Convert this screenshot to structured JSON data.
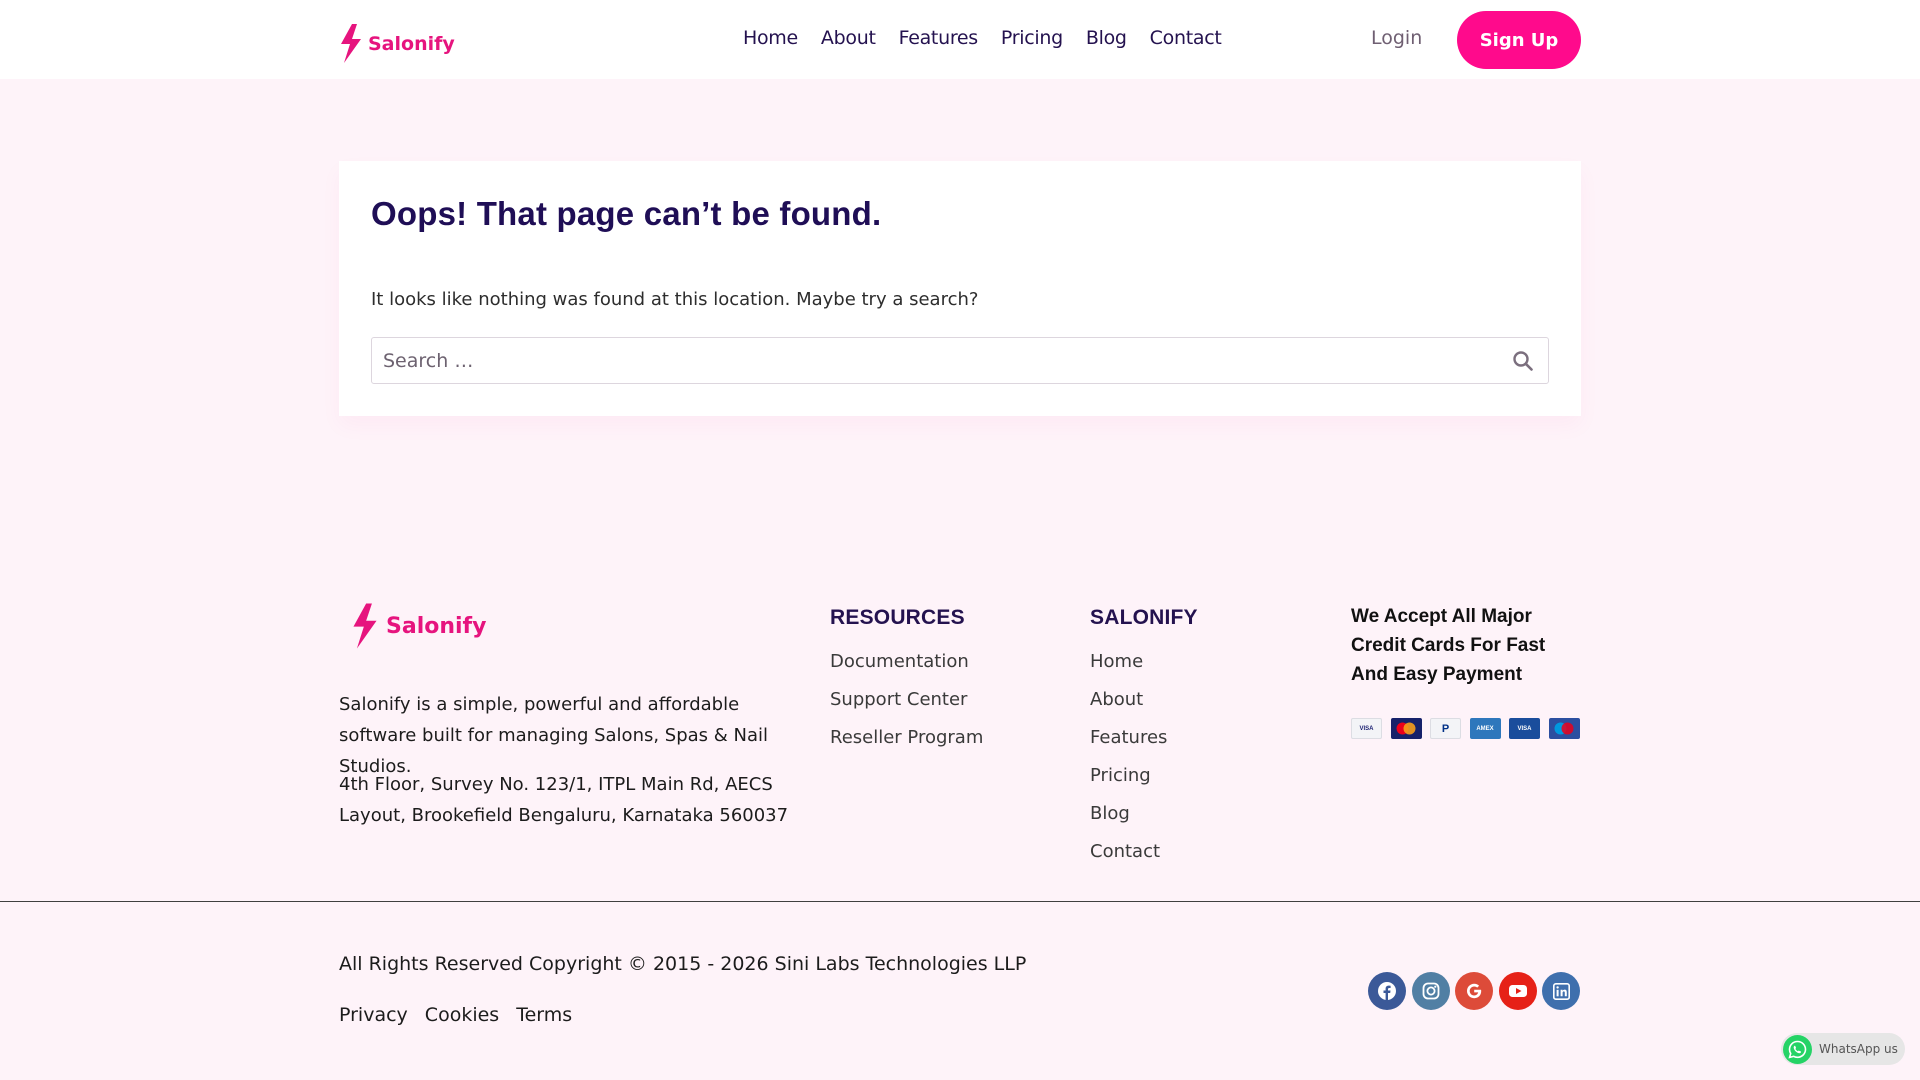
{
  "brand": {
    "name": "Salonify",
    "color": "#e6147e"
  },
  "header": {
    "nav": [
      "Home",
      "About",
      "Features",
      "Pricing",
      "Blog",
      "Contact"
    ],
    "login_label": "Login",
    "signup_label": "Sign Up",
    "signup_color": "#ff0a8c"
  },
  "main": {
    "title": "Oops! That page can’t be found.",
    "message": "It looks like nothing was found at this location. Maybe try a search?",
    "search": {
      "placeholder": "Search …",
      "value": ""
    }
  },
  "footer": {
    "about": "Salonify is a simple, powerful and affordable software built for managing Salons, Spas & Nail Studios.",
    "address": "4th Floor, Survey No. 123/1, ITPL Main Rd, AECS Layout, Brookefield Bengaluru, Karnataka 560037",
    "resources": {
      "heading": "RESOURCES",
      "links": [
        "Documentation",
        "Support Center",
        "Reseller Program"
      ]
    },
    "salonify": {
      "heading": "SALONIFY",
      "links": [
        "Home",
        "About",
        "Features",
        "Pricing",
        "Blog",
        "Contact"
      ]
    },
    "payments": {
      "heading": "We Accept All Major Credit Cards For Fast And Easy Payment",
      "cards": [
        "visa-card-icon",
        "mastercard-icon",
        "paypal-icon",
        "american-express-icon",
        "visa-electron-icon",
        "maestro-icon"
      ]
    },
    "copyright": "All Rights Reserved Copyright © 2015 - 2026 Sini Labs Technologies LLP",
    "legal": [
      "Privacy",
      "Cookies",
      "Terms"
    ],
    "socials": [
      {
        "icon": "facebook-icon",
        "color": "#3b5998"
      },
      {
        "icon": "instagram-icon",
        "color": "#517fa4"
      },
      {
        "icon": "google-icon",
        "color": "#dd4b39"
      },
      {
        "icon": "youtube-icon",
        "color": "#e62117"
      },
      {
        "icon": "linkedin-icon",
        "color": "#3f6fad"
      }
    ]
  },
  "whatsapp": {
    "label": "WhatsApp us",
    "color": "#25d366"
  }
}
